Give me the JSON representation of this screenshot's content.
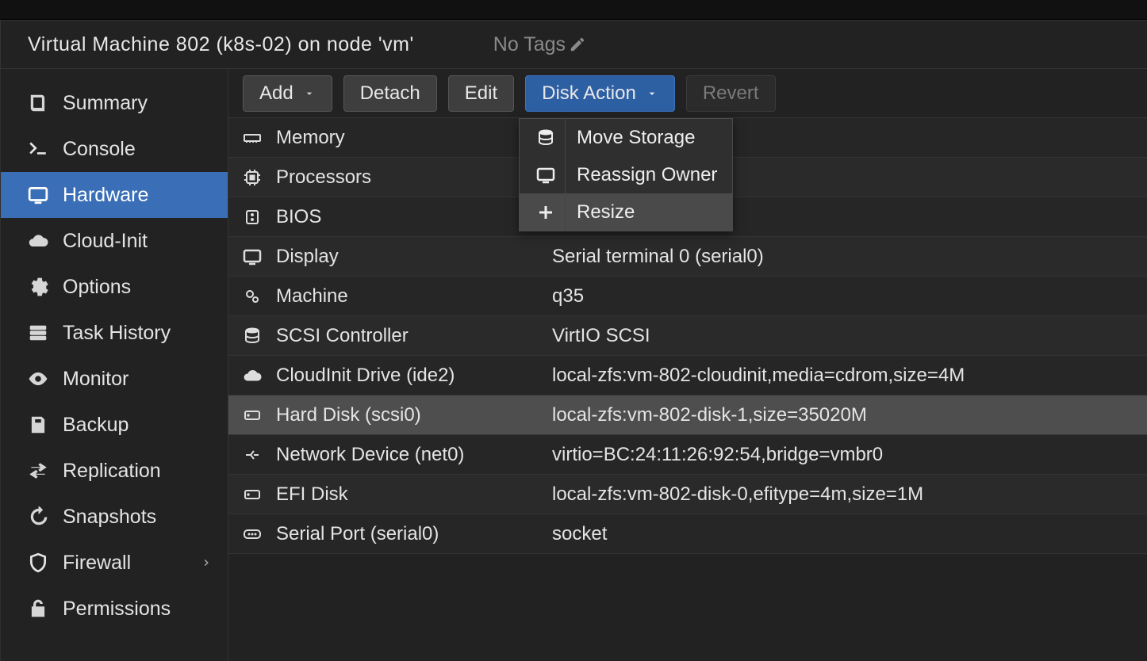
{
  "header": {
    "title": "Virtual Machine 802 (k8s-02) on node 'vm'",
    "no_tags_label": "No Tags"
  },
  "sidebar": {
    "items": [
      {
        "label": "Summary",
        "icon": "book-icon"
      },
      {
        "label": "Console",
        "icon": "terminal-icon"
      },
      {
        "label": "Hardware",
        "icon": "monitor-icon",
        "active": true
      },
      {
        "label": "Cloud-Init",
        "icon": "cloud-icon"
      },
      {
        "label": "Options",
        "icon": "gear-icon"
      },
      {
        "label": "Task History",
        "icon": "list-icon"
      },
      {
        "label": "Monitor",
        "icon": "eye-icon"
      },
      {
        "label": "Backup",
        "icon": "save-icon"
      },
      {
        "label": "Replication",
        "icon": "sync-icon"
      },
      {
        "label": "Snapshots",
        "icon": "history-icon"
      },
      {
        "label": "Firewall",
        "icon": "shield-icon",
        "submenu": true
      },
      {
        "label": "Permissions",
        "icon": "unlock-icon"
      }
    ]
  },
  "toolbar": {
    "add_label": "Add",
    "detach_label": "Detach",
    "edit_label": "Edit",
    "disk_action_label": "Disk Action",
    "revert_label": "Revert"
  },
  "disk_action_menu": {
    "items": [
      {
        "label": "Move Storage",
        "icon": "database-icon"
      },
      {
        "label": "Reassign Owner",
        "icon": "monitor-icon"
      },
      {
        "label": "Resize",
        "icon": "plus-icon",
        "hover": true
      }
    ]
  },
  "hardware_rows": [
    {
      "icon": "memory-icon",
      "key": "Memory",
      "value": ""
    },
    {
      "icon": "cpu-icon",
      "key": "Processors",
      "value": ""
    },
    {
      "icon": "chip-icon",
      "key": "BIOS",
      "value": ""
    },
    {
      "icon": "monitor-icon",
      "key": "Display",
      "value": "Serial terminal 0 (serial0)"
    },
    {
      "icon": "gears-icon",
      "key": "Machine",
      "value": "q35"
    },
    {
      "icon": "database-icon",
      "key": "SCSI Controller",
      "value": "VirtIO SCSI"
    },
    {
      "icon": "cloud-icon",
      "key": "CloudInit Drive (ide2)",
      "value": "local-zfs:vm-802-cloudinit,media=cdrom,size=4M"
    },
    {
      "icon": "hdd-icon",
      "key": "Hard Disk (scsi0)",
      "value": "local-zfs:vm-802-disk-1,size=35020M",
      "selected": true
    },
    {
      "icon": "network-icon",
      "key": "Network Device (net0)",
      "value": "virtio=BC:24:11:26:92:54,bridge=vmbr0"
    },
    {
      "icon": "hdd-icon",
      "key": "EFI Disk",
      "value": "local-zfs:vm-802-disk-0,efitype=4m,size=1M"
    },
    {
      "icon": "serial-icon",
      "key": "Serial Port (serial0)",
      "value": "socket"
    }
  ]
}
